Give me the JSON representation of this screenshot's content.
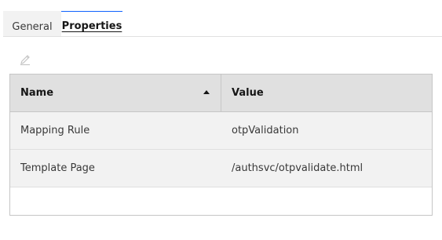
{
  "tabs": [
    {
      "label": "General",
      "active": false
    },
    {
      "label": "Properties",
      "active": true
    }
  ],
  "toolbar": {
    "edit_icon": "pencil-icon"
  },
  "table": {
    "columns": [
      {
        "label": "Name",
        "sort": "ascending"
      },
      {
        "label": "Value"
      }
    ],
    "rows": [
      {
        "name": "Mapping Rule",
        "value": "otpValidation"
      },
      {
        "name": "Template Page",
        "value": "/authsvc/otpvalidate.html"
      }
    ]
  },
  "colors": {
    "active_tab_accent": "#0f62fe",
    "header_bg": "#e0e0e0",
    "row_bg": "#f2f2f2"
  }
}
